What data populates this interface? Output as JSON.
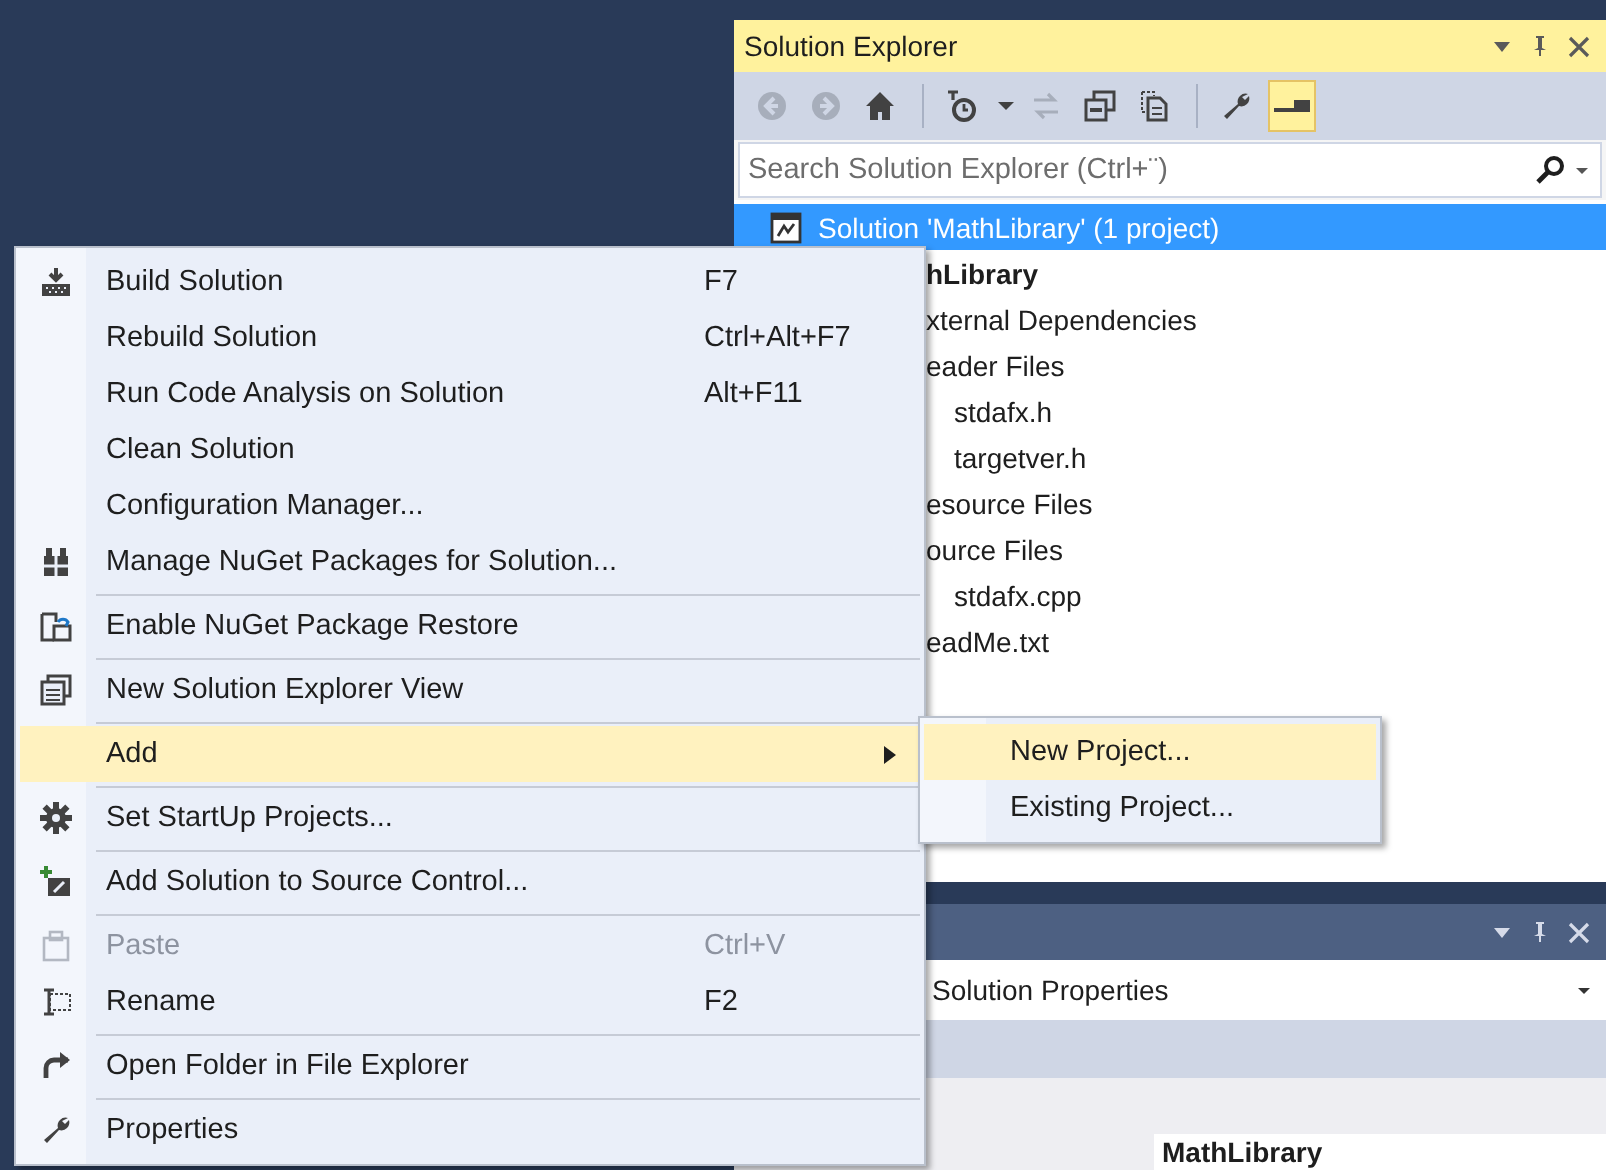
{
  "solution_explorer": {
    "title": "Solution Explorer",
    "toolbar": [
      {
        "kind": "button",
        "disabled": true,
        "on": false
      },
      {
        "kind": "button",
        "disabled": true,
        "on": false
      },
      {
        "kind": "button",
        "disabled": false,
        "on": false
      },
      {
        "kind": "separator"
      },
      {
        "kind": "button",
        "disabled": false,
        "on": false
      },
      {
        "kind": "dropdown",
        "disabled": false,
        "on": false
      },
      {
        "kind": "button",
        "disabled": true,
        "on": false
      },
      {
        "kind": "button",
        "disabled": false,
        "on": false
      },
      {
        "kind": "button",
        "disabled": false,
        "on": false
      },
      {
        "kind": "separator"
      },
      {
        "kind": "button",
        "disabled": false,
        "on": false
      },
      {
        "kind": "button",
        "disabled": false,
        "on": true
      }
    ],
    "search": {
      "placeholder": "Search Solution Explorer (Ctrl+¨)"
    },
    "tree": [
      {
        "label": "Solution 'MathLibrary' (1 project)",
        "selected": true,
        "children": [
          {
            "label": "hLibrary",
            "selected": false,
            "children": [
              {
                "label": "xternal Dependencies",
                "selected": false
              },
              {
                "label": "eader Files",
                "selected": false,
                "children": [
                  {
                    "label": "stdafx.h",
                    "selected": false
                  },
                  {
                    "label": "targetver.h",
                    "selected": false
                  }
                ]
              },
              {
                "label": "esource Files",
                "selected": false
              },
              {
                "label": "ource Files",
                "selected": false,
                "children": [
                  {
                    "label": "stdafx.cpp",
                    "selected": false
                  }
                ]
              },
              {
                "label": "eadMe.txt",
                "selected": false
              }
            ]
          }
        ]
      }
    ]
  },
  "properties": {
    "object": "Solution Properties",
    "value": "MathLibrary"
  },
  "menu": {
    "items": [
      {
        "kind": "item",
        "label": "Build Solution",
        "shortcut": "F7",
        "selected": false,
        "disabled": false
      },
      {
        "kind": "item",
        "label": "Rebuild Solution",
        "shortcut": "Ctrl+Alt+F7",
        "selected": false,
        "disabled": false
      },
      {
        "kind": "item",
        "label": "Run Code Analysis on Solution",
        "shortcut": "Alt+F11",
        "selected": false,
        "disabled": false
      },
      {
        "kind": "item",
        "label": "Clean Solution",
        "selected": false,
        "disabled": false
      },
      {
        "kind": "item",
        "label": "Configuration Manager...",
        "selected": false,
        "disabled": false
      },
      {
        "kind": "item",
        "label": "Manage NuGet Packages for Solution...",
        "selected": false,
        "disabled": false
      },
      {
        "kind": "separator"
      },
      {
        "kind": "item",
        "label": "Enable NuGet Package Restore",
        "selected": false,
        "disabled": false
      },
      {
        "kind": "separator"
      },
      {
        "kind": "item",
        "label": "New Solution Explorer View",
        "selected": false,
        "disabled": false
      },
      {
        "kind": "separator"
      },
      {
        "kind": "item",
        "label": "Add",
        "selected": true,
        "disabled": false,
        "submenu": [
          {
            "label": "New Project...",
            "selected": true
          },
          {
            "label": "Existing Project...",
            "selected": false
          }
        ]
      },
      {
        "kind": "separator"
      },
      {
        "kind": "item",
        "label": "Set StartUp Projects...",
        "selected": false,
        "disabled": false
      },
      {
        "kind": "separator"
      },
      {
        "kind": "item",
        "label": "Add Solution to Source Control...",
        "selected": false,
        "disabled": false
      },
      {
        "kind": "separator"
      },
      {
        "kind": "item",
        "label": "Paste",
        "shortcut": "Ctrl+V",
        "selected": false,
        "disabled": true
      },
      {
        "kind": "item",
        "label": "Rename",
        "shortcut": "F2",
        "selected": false,
        "disabled": false
      },
      {
        "kind": "separator"
      },
      {
        "kind": "item",
        "label": "Open Folder in File Explorer",
        "selected": false,
        "disabled": false
      },
      {
        "kind": "separator"
      },
      {
        "kind": "item",
        "label": "Properties",
        "selected": false,
        "disabled": false
      }
    ]
  }
}
